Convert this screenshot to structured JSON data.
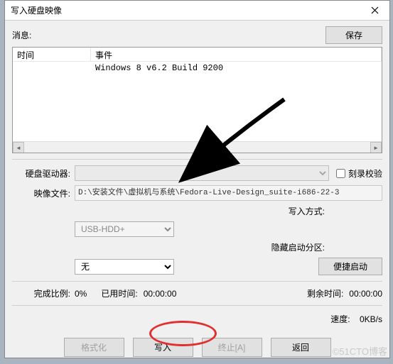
{
  "window": {
    "title": "写入硬盘映像"
  },
  "toolbar": {
    "info_label": "消息:",
    "save_label": "保存"
  },
  "list": {
    "col_time": "时间",
    "col_event": "事件",
    "event1": "Windows 8 v6.2 Build 9200"
  },
  "form": {
    "drive_label": "硬盘驱动器:",
    "drive_value": "",
    "verify_label": "刻录校验",
    "image_label": "映像文件:",
    "image_value": "D:\\安装文件\\虚拟机与系统\\Fedora-Live-Design_suite-i686-22-3",
    "write_mode_label": "写入方式:",
    "write_mode_value": "USB-HDD+",
    "hide_boot_label": "隐藏启动分区:",
    "hide_boot_value": "无",
    "quick_boot_label": "便捷启动"
  },
  "progress": {
    "ratio_label": "完成比例:",
    "ratio_value": "0%",
    "used_label": "已用时间:",
    "used_value": "00:00:00",
    "remain_label": "剩余时间:",
    "remain_value": "00:00:00",
    "speed_label": "速度:",
    "speed_value": "0KB/s"
  },
  "buttons": {
    "format": "格式化",
    "write": "写入",
    "abort": "终止[A]",
    "return": "返回"
  },
  "watermark": "©51CTO博客"
}
